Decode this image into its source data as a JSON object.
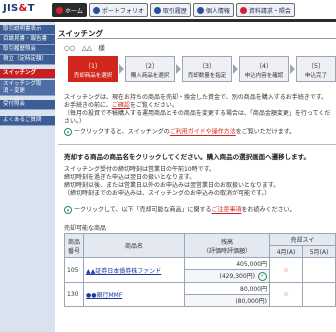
{
  "header": {
    "logo_prefix": "JIS",
    "logo_amp": "&",
    "logo_suffix": "T",
    "tabs": [
      {
        "label": "ホーム",
        "active": true
      },
      {
        "label": "ポートフォリオ"
      },
      {
        "label": "取引履歴"
      },
      {
        "label": "個人情報"
      },
      {
        "label": "資料請求・照会"
      }
    ]
  },
  "sidebar": {
    "items": [
      {
        "label": "取引説明書表示"
      },
      {
        "label": "目論見書・報告書"
      },
      {
        "label": "取引履歴照会"
      },
      {
        "label": "積立（定時定額）"
      },
      {
        "label": "スイッチング",
        "active": true
      },
      {
        "label": "スイッチング取消・変更"
      },
      {
        "label": "受付照会"
      },
      {
        "label": "よくあるご質問"
      }
    ]
  },
  "page": {
    "title": "スイッチング",
    "user_line": "○○　△△　様"
  },
  "steps": [
    {
      "num": "（1）",
      "label": "売却商品を選択"
    },
    {
      "num": "（2）",
      "label": "購入商品を選択"
    },
    {
      "num": "（3）",
      "label": "売却数量を指定"
    },
    {
      "num": "（4）",
      "label": "申込内容を確認"
    },
    {
      "num": "（5）",
      "label": "申込完了"
    }
  ],
  "intro": {
    "line1": "スイッチングは、現在お持ちの商品を売却・換金した資金で、別の商品を購入するお手続きです。",
    "line2_pre": "お手続きの前に、",
    "line2_link": "ご確認",
    "line2_post": "をご覧ください。",
    "line3": "（毎月の投資で不積購入する運用商品とその商品を変更する場合は、「商品金額変更」を行ってください。）",
    "help_pre": "ークリックすると、スイッチングの",
    "help_link": "ご利用ガイドや操作方法",
    "help_post": "をご覧いただけます。"
  },
  "section": {
    "title": "売却する商品の商品名をクリックしてください。購入商品の選択画面へ遷移します。",
    "p1": "スイッチング受付の締切時刻は営業日の午前10時です。",
    "p2": "締切時刻を過ぎた申込は翌日の扱いとなります。",
    "p3": "締切時刻以後、または営業日以外のお申込みは翌営業日のお取扱いとなります。",
    "p4": "（締切時刻までのお申込みは、スイッチングのお申込みの取消が可能です。）",
    "note_pre": "ークリックして、以下「売却可能な商品」に関する",
    "note_link": "ご注意事項",
    "note_post": "をお読みください。"
  },
  "table": {
    "caption": "売却可能な商品",
    "headers": {
      "code": "商品番号",
      "name": "商品名",
      "value": "残高",
      "value_sub": "（評価時評価額）",
      "switch_group": "売却スイ",
      "col_a": "4月(A)",
      "col_b": "5月(A)"
    },
    "rows": [
      {
        "code": "105",
        "name": "▲▲証券日本債券株ファンド",
        "amount": "405,000円",
        "amount_paren": "(429,300円)",
        "star": "☆"
      },
      {
        "code": "130",
        "name": "●●銀行MMF",
        "amount": "80,000円",
        "amount_paren": "(80,000円)",
        "star": "☆"
      }
    ]
  }
}
